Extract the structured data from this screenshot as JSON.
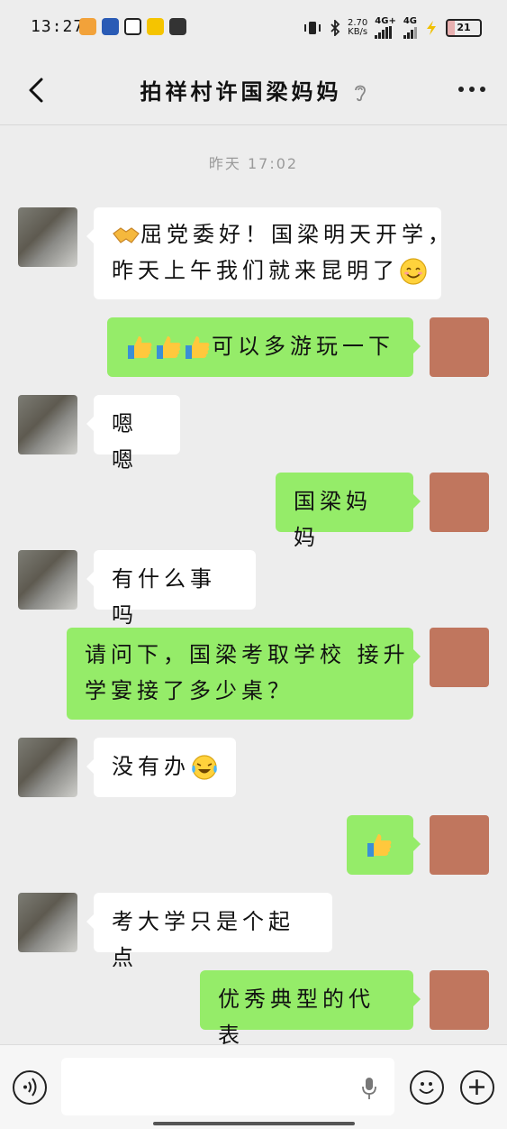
{
  "status_bar": {
    "time": "13:27",
    "speed_value": "2.70",
    "speed_unit": "KB/s",
    "net1": "4G+",
    "net2": "4G",
    "battery": "21"
  },
  "header": {
    "title": "拍祥村许国梁妈妈"
  },
  "timestamp": "昨天 17:02",
  "messages": [
    {
      "side": "left",
      "text": "屈党委好！国梁明天开学，",
      "text2": "昨天上午我们就来昆明了",
      "icons": [
        "handshake-emoji",
        "smile-emoji"
      ]
    },
    {
      "side": "right",
      "text": "可以多游玩一下",
      "icons": [
        "thumbs-up-emoji",
        "thumbs-up-emoji",
        "thumbs-up-emoji"
      ]
    },
    {
      "side": "left",
      "text": "嗯嗯"
    },
    {
      "side": "right",
      "text": "国梁妈妈"
    },
    {
      "side": "left",
      "text": "有什么事吗"
    },
    {
      "side": "right",
      "text": "请问下，国梁考取学校 接升",
      "text2": "学宴接了多少桌？"
    },
    {
      "side": "left",
      "text": "没有办",
      "icons": [
        "crying-laugh-emoji"
      ]
    },
    {
      "side": "right",
      "text": "",
      "icons": [
        "thumbs-up-emoji"
      ]
    },
    {
      "side": "left",
      "text": "考大学只是个起点"
    },
    {
      "side": "right",
      "text": "优秀典型的代表"
    }
  ],
  "colors": {
    "background": "#ededed",
    "sent_bubble": "#95ec69",
    "received_bubble": "#ffffff"
  }
}
